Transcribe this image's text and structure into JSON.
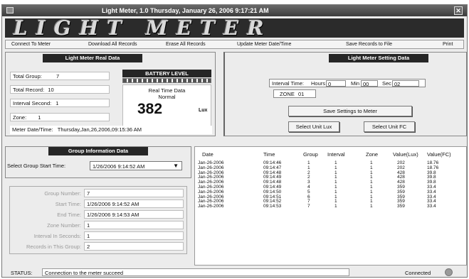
{
  "window": {
    "title": "Light Meter, 1.0  Thursday, January 26, 2006 9:17:21 AM",
    "banner": "LIGHT METER"
  },
  "menu": [
    "Connect To Meter",
    "Download All Records",
    "Erase All Records",
    "Update Meter Date/Time",
    "Save Records to File",
    "Print"
  ],
  "real_data": {
    "header": "Light Meter Real Data",
    "total_group_label": "Total Group:",
    "total_group": "7",
    "total_record_label": "Total Record:",
    "total_record": "10",
    "interval_label": "Interval Second:",
    "interval": "1",
    "zone_label": "Zone:",
    "zone": "1",
    "battery_label": "BATTERY LEVEL",
    "battery_level": 1.0,
    "realtime_label": "Real Time Data",
    "realtime_status": "Normal",
    "reading": "382",
    "unit": "Lux",
    "meter_datetime_label": "Meter Date/Time:",
    "meter_datetime": "Thursday,Jan,26,2006,09:15:36 AM"
  },
  "settings": {
    "header": "Light Meter Setting Data",
    "interval_time_label": "Interval Time:",
    "hours_label": "Hours",
    "hours": "0",
    "min_label": "Min",
    "min": "00",
    "sec_label": "Sec",
    "sec": "02",
    "zone_label": "ZONE",
    "zone": "01",
    "save_button": "Save Settings to Meter",
    "lux_button": "Select Unit Lux",
    "fc_button": "Select Unit FC"
  },
  "group_info": {
    "header": "Group Information Data",
    "select_label": "Select Group Start Time:",
    "select_value": "1/26/2006 9:14:52 AM",
    "group_number_label": "Group Number:",
    "group_number": "7",
    "start_time_label": "Start Time:",
    "start_time": "1/26/2006 9:14:52 AM",
    "end_time_label": "End Time:",
    "end_time": "1/26/2006 9:14:53 AM",
    "zone_number_label": "Zone Number:",
    "zone_number": "1",
    "interval_label": "Interval In Seconds:",
    "interval": "1",
    "records_label": "Records in This Group:",
    "records": "2"
  },
  "records": {
    "columns": [
      "Date",
      "Time",
      "Group",
      "Interval",
      "Zone",
      "Value(Lux)",
      "Value(FC)"
    ],
    "rows": [
      [
        "Jan-26-2006",
        "09:14:46",
        "1",
        "1",
        "1",
        "202",
        "18.76"
      ],
      [
        "Jan-26-2006",
        "09:14:47",
        "1",
        "1",
        "1",
        "202",
        "18.76"
      ],
      [
        "Jan-26-2006",
        "09:14:48",
        "2",
        "1",
        "1",
        "428",
        "39.8"
      ],
      [
        "Jan-26-2006",
        "09:14:49",
        "2",
        "1",
        "1",
        "428",
        "39.8"
      ],
      [
        "Jan-26-2006",
        "09:14:48",
        "3",
        "1",
        "1",
        "428",
        "39.8"
      ],
      [
        "Jan-26-2006",
        "09:14:49",
        "4",
        "1",
        "1",
        "359",
        "33.4"
      ],
      [
        "Jan-26-2006",
        "09:14:50",
        "5",
        "1",
        "1",
        "359",
        "33.4"
      ],
      [
        "Jan-26-2006",
        "09:14:51",
        "6",
        "1",
        "1",
        "359",
        "33.4"
      ],
      [
        "Jan-26-2006",
        "09:14:52",
        "7",
        "1",
        "1",
        "359",
        "33.4"
      ],
      [
        "Jan-26-2006",
        "09:14:53",
        "7",
        "1",
        "1",
        "359",
        "33.4"
      ]
    ]
  },
  "status": {
    "label": "STATUS:",
    "message": "Connection to the meter succeed",
    "connection": "Connected"
  },
  "colors": {
    "header_bg": "#262626",
    "battery_fill": "#555555",
    "connected_led": "#9a9a9a"
  }
}
